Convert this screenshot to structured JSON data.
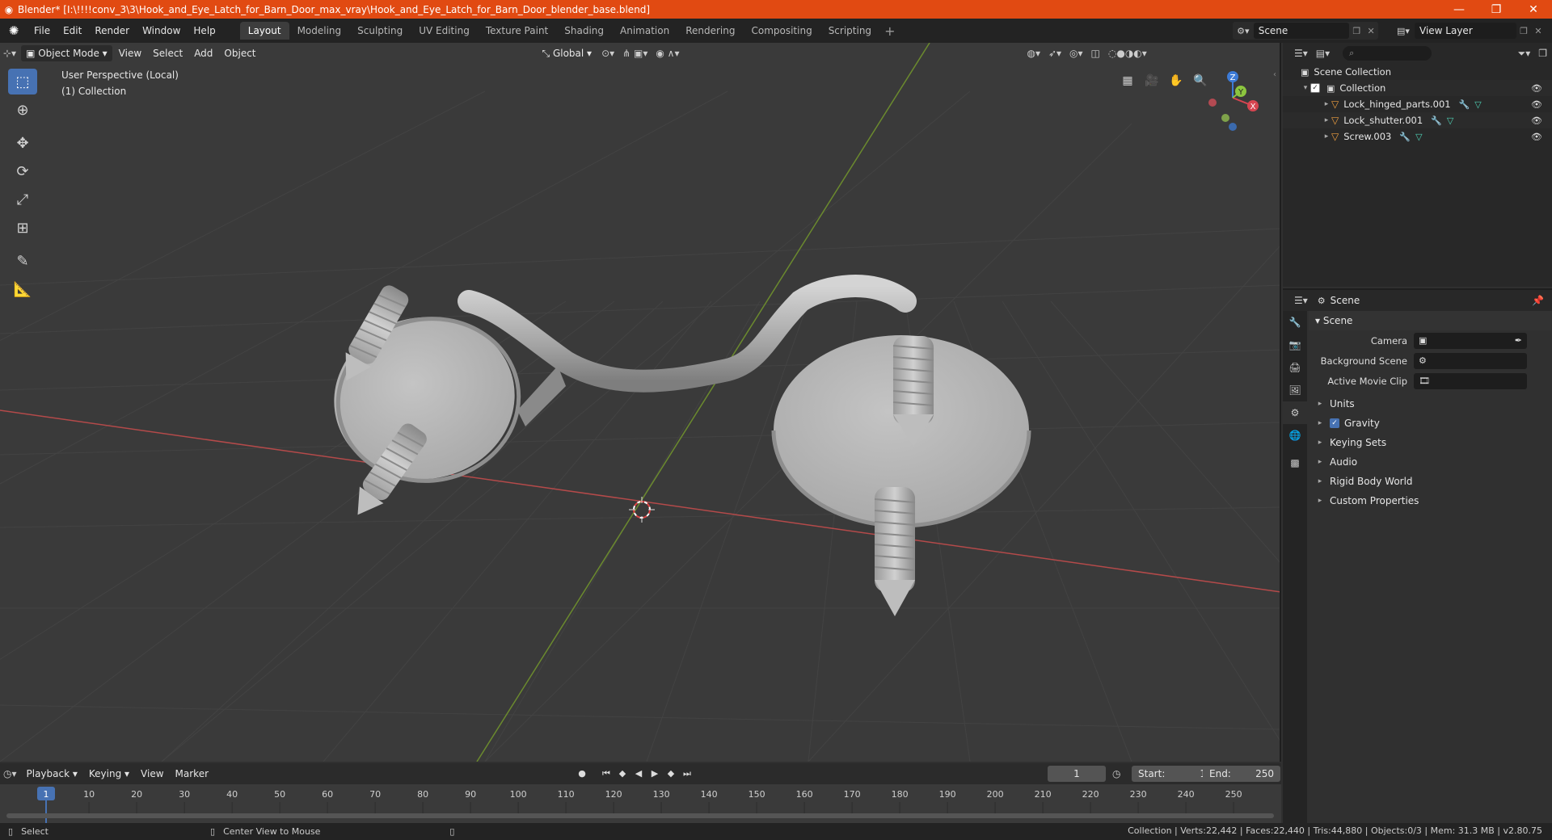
{
  "window": {
    "title": "Blender* [I:\\!!!!conv_3\\3\\Hook_and_Eye_Latch_for_Barn_Door_max_vray\\Hook_and_Eye_Latch_for_Barn_Door_blender_base.blend]",
    "controls": [
      "—",
      "❐",
      "✕"
    ]
  },
  "menu": [
    "File",
    "Edit",
    "Render",
    "Window",
    "Help"
  ],
  "workspaces": [
    "Layout",
    "Modeling",
    "Sculpting",
    "UV Editing",
    "Texture Paint",
    "Shading",
    "Animation",
    "Rendering",
    "Compositing",
    "Scripting"
  ],
  "active_workspace": "Layout",
  "scene_name": "Scene",
  "view_layer": "View Layer",
  "viewport": {
    "mode": "Object Mode",
    "menus": [
      "View",
      "Select",
      "Add",
      "Object"
    ],
    "orientation": "Global",
    "info_line1": "User Perspective (Local)",
    "info_line2": "(1) Collection",
    "gizmo": {
      "x": "X",
      "y": "Y",
      "z": "Z"
    }
  },
  "outliner": {
    "root": "Scene Collection",
    "collection": "Collection",
    "objects": [
      "Lock_hinged_parts.001",
      "Lock_shutter.001",
      "Screw.003"
    ]
  },
  "properties": {
    "header": "Scene",
    "panel": "Scene",
    "fields": [
      {
        "label": "Camera",
        "value": ""
      },
      {
        "label": "Background Scene",
        "value": ""
      },
      {
        "label": "Active Movie Clip",
        "value": ""
      }
    ],
    "subpanels": [
      "Units",
      "Gravity",
      "Keying Sets",
      "Audio",
      "Rigid Body World",
      "Custom Properties"
    ]
  },
  "timeline": {
    "menus": [
      "Playback",
      "Keying",
      "View",
      "Marker"
    ],
    "current_frame": "1",
    "start_label": "Start:",
    "start": "1",
    "end_label": "End:",
    "end": "250",
    "ruler_marks": [
      "1",
      "10",
      "20",
      "30",
      "40",
      "50",
      "60",
      "70",
      "80",
      "90",
      "100",
      "110",
      "120",
      "130",
      "140",
      "150",
      "160",
      "170",
      "180",
      "190",
      "200",
      "210",
      "220",
      "230",
      "240",
      "250"
    ]
  },
  "statusbar": {
    "select": "Select",
    "center_view": "Center View to Mouse",
    "stats": "Collection | Verts:22,442 | Faces:22,440 | Tris:44,880 | Objects:0/3 | Mem: 31.3 MB | v2.80.75"
  }
}
